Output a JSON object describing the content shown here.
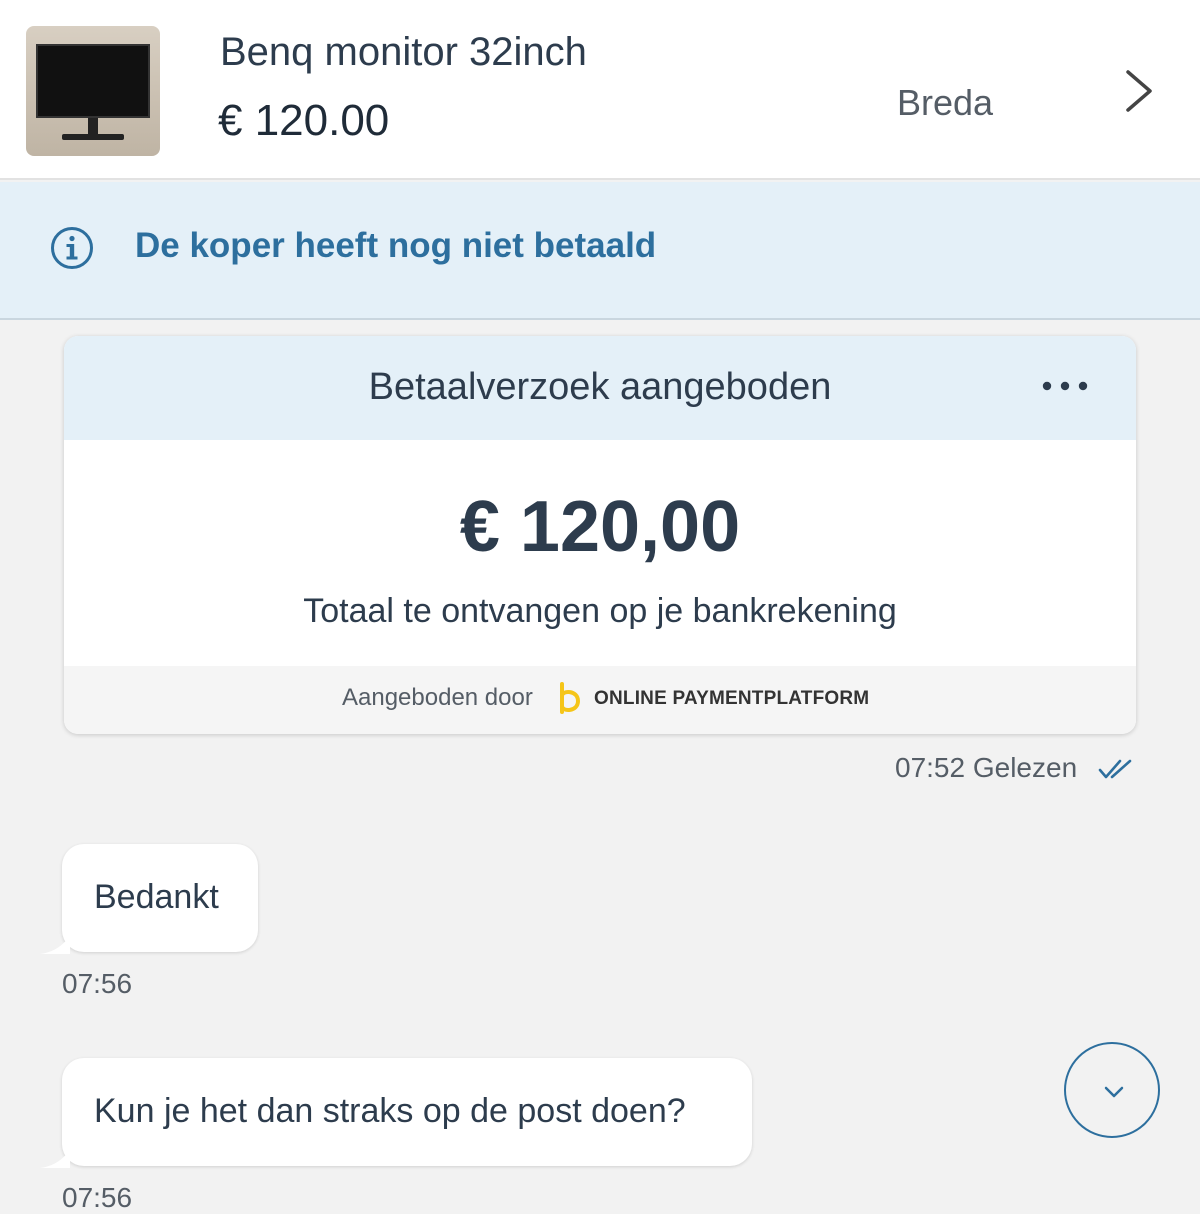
{
  "listing": {
    "title": "Benq monitor 32inch",
    "price": "€ 120.00",
    "location": "Breda",
    "thumbnail_icon": "monitor-photo",
    "open_icon": "chevron-right-icon"
  },
  "banner": {
    "icon": "info-icon",
    "text": "De koper heeft nog niet betaald",
    "background": "#e4f0f8",
    "text_color": "#2d6f9e"
  },
  "payment_card": {
    "title": "Betaalverzoek aangeboden",
    "menu_icon": "more-horizontal-icon",
    "amount": "€ 120,00",
    "subtitle": "Totaal te ontvangen op je bankrekening",
    "offered_by": "Aangeboden door",
    "provider": "ONLINE PAYMENTPLATFORM",
    "provider_logo_color": "#f5c518",
    "sent_time": "07:52",
    "read_status": "Gelezen"
  },
  "messages": [
    {
      "text": "Bedankt",
      "time": "07:56"
    },
    {
      "text": "Kun je het dan straks op de post doen?",
      "time": "07:56"
    }
  ],
  "scroll_button": {
    "icon": "chevron-down-icon"
  }
}
